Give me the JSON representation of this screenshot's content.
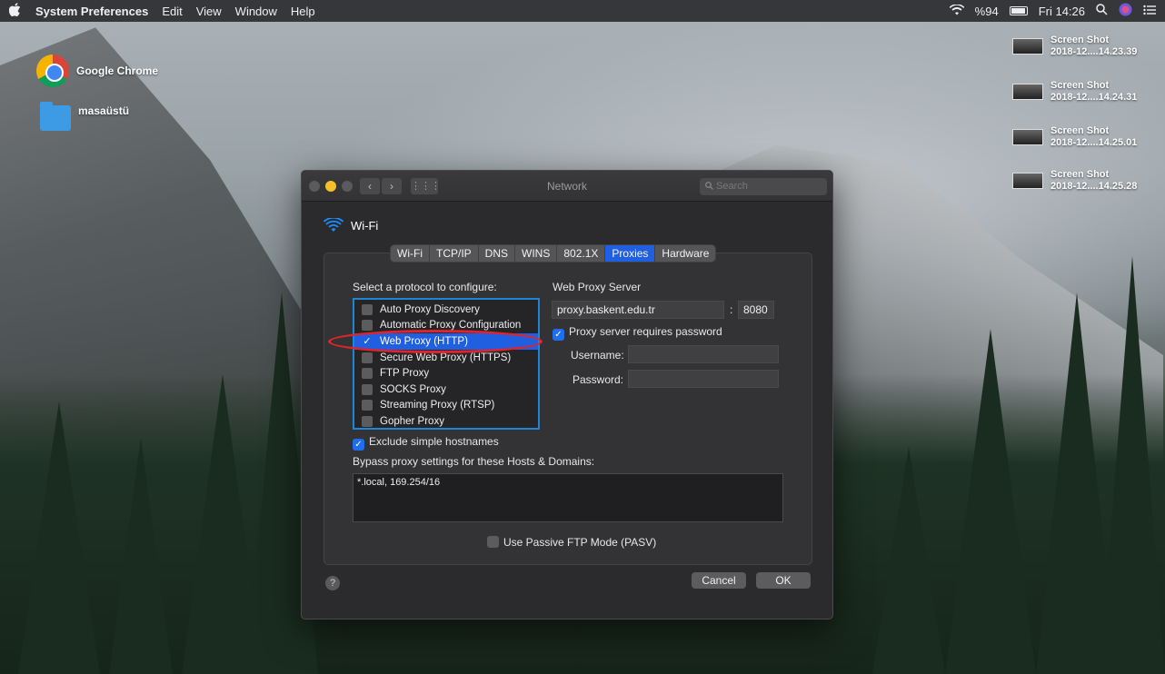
{
  "menubar": {
    "apple": "",
    "app_name": "System Preferences",
    "items": [
      "Edit",
      "View",
      "Window",
      "Help"
    ],
    "battery_text": "%94",
    "clock": "Fri 14:26"
  },
  "desktop": {
    "icons": [
      {
        "label": "Google Chrome",
        "icon": "chrome-icon"
      },
      {
        "label": "masaüstü",
        "icon": "folder-icon"
      }
    ],
    "screenshots": [
      {
        "line1": "Screen Shot",
        "line2": "2018-12....14.23.39"
      },
      {
        "line1": "Screen Shot",
        "line2": "2018-12....14.24.31"
      },
      {
        "line1": "Screen Shot",
        "line2": "2018-12....14.25.01"
      },
      {
        "line1": "Screen Shot",
        "line2": "2018-12....14.25.28"
      }
    ]
  },
  "window": {
    "title": "Network",
    "search_placeholder": "Search",
    "interface_name": "Wi-Fi",
    "tabs": [
      "Wi-Fi",
      "TCP/IP",
      "DNS",
      "WINS",
      "802.1X",
      "Proxies",
      "Hardware"
    ],
    "active_tab": "Proxies",
    "protocol_label": "Select a protocol to configure:",
    "protocols": [
      {
        "label": "Auto Proxy Discovery",
        "checked": false
      },
      {
        "label": "Automatic Proxy Configuration",
        "checked": false
      },
      {
        "label": "Web Proxy (HTTP)",
        "checked": true
      },
      {
        "label": "Secure Web Proxy (HTTPS)",
        "checked": false
      },
      {
        "label": "FTP Proxy",
        "checked": false
      },
      {
        "label": "SOCKS Proxy",
        "checked": false
      },
      {
        "label": "Streaming Proxy (RTSP)",
        "checked": false
      },
      {
        "label": "Gopher Proxy",
        "checked": false
      }
    ],
    "web_proxy_server_label": "Web Proxy Server",
    "proxy_host": "proxy.baskent.edu.tr",
    "port_separator": ":",
    "proxy_port": "8080",
    "requires_password_label": "Proxy server requires password",
    "username_label": "Username:",
    "password_label": "Password:",
    "username_value": "",
    "password_value": "",
    "exclude_label": "Exclude simple hostnames",
    "bypass_label": "Bypass proxy settings for these Hosts & Domains:",
    "bypass_value": "*.local, 169.254/16",
    "pasv_label": "Use Passive FTP Mode (PASV)",
    "help": "?",
    "cancel": "Cancel",
    "ok": "OK"
  },
  "colors": {
    "accent": "#1f5fe0",
    "highlight_circle": "#e0242b",
    "list_border": "#1d86d6"
  }
}
